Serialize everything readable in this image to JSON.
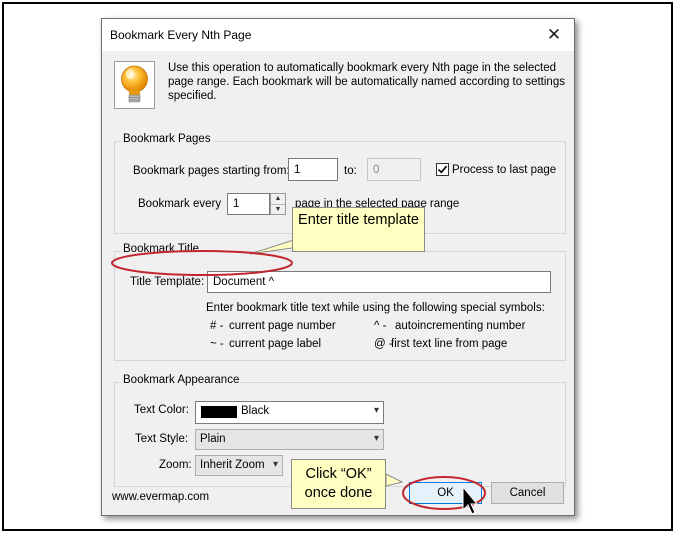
{
  "dialog": {
    "title": "Bookmark Every Nth Page",
    "close_glyph": "✕",
    "intro_text": "Use this operation to automatically bookmark every Nth page in the selected page range.  Each bookmark will be automatically named according to settings specified."
  },
  "bookmark_pages": {
    "group_label": "Bookmark Pages",
    "starting_label": "Bookmark pages starting from:",
    "starting_value": "1",
    "to_label": "to:",
    "to_value": "0",
    "process_last_label": "Process to last page",
    "process_last_checked": true,
    "every_label": "Bookmark every",
    "every_value": "1",
    "every_suffix": "page in the selected page range"
  },
  "bookmark_title": {
    "group_label": "Bookmark Title",
    "template_label": "Title Template:",
    "template_value": "Document ^",
    "help_text": "Enter bookmark title text while using the following special symbols:",
    "symbols": [
      {
        "key": "# -",
        "desc": "current page number"
      },
      {
        "key": "^ -",
        "desc": "autoincrementing number"
      },
      {
        "key": "~ -",
        "desc": "current page label"
      },
      {
        "key": "@ -",
        "desc": "first text line from page"
      }
    ]
  },
  "bookmark_appearance": {
    "group_label": "Bookmark Appearance",
    "text_color_label": "Text Color:",
    "text_color_value": "Black",
    "text_style_label": "Text Style:",
    "text_style_value": "Plain",
    "zoom_label": "Zoom:",
    "zoom_value": "Inherit Zoom"
  },
  "footer": {
    "website": "www.evermap.com",
    "ok_label": "OK",
    "cancel_label": "Cancel"
  },
  "callouts": {
    "title_template": "Enter title template",
    "ok_hint": "Click “OK” once done"
  },
  "colors": {
    "annotation_ring": "#c1272d",
    "callout_fill": "#ffffc2",
    "default_button_border": "#0078d7"
  }
}
